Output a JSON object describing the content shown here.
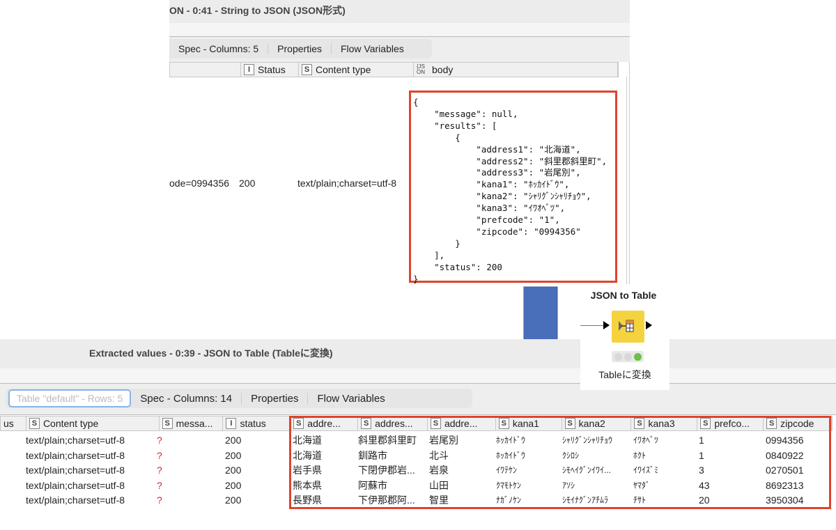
{
  "top_window": {
    "title": "ON - 0:41 - String to JSON (JSON形式)",
    "tabs": [
      "Spec - Columns: 5",
      "Properties",
      "Flow Variables"
    ],
    "columns": [
      {
        "type": "I",
        "label": "Status"
      },
      {
        "type": "S",
        "label": "Content type"
      },
      {
        "type": "{JS ON",
        "label": "body"
      }
    ],
    "row": {
      "partial_url": "ode=0994356",
      "status": "200",
      "content_type": "text/plain;charset=utf-8"
    },
    "json_body": "{\n    \"message\": null,\n    \"results\": [\n        {\n            \"address1\": \"北海道\",\n            \"address2\": \"斜里郡斜里町\",\n            \"address3\": \"岩尾別\",\n            \"kana1\": \"ﾎｯｶｲﾄﾞｳ\",\n            \"kana2\": \"ｼｬﾘｸﾞﾝｼｬﾘﾁｮｳ\",\n            \"kana3\": \"ｲﾜｵﾍﾞﾂ\",\n            \"prefcode\": \"1\",\n            \"zipcode\": \"0994356\"\n        }\n    ],\n    \"status\": 200\n}"
  },
  "node": {
    "title": "JSON to Table",
    "label": "Tableに変換",
    "color": "#f5d33f",
    "status_colors": [
      "#d8d8d8",
      "#d8d8d8",
      "#6cc04a"
    ]
  },
  "arrow_color": "#4a6fba",
  "highlight_color": "#e0432b",
  "bottom_window": {
    "title": "Extracted values - 0:39 - JSON to Table (Tableに変換)",
    "tabs": [
      "Table \"default\" - Rows: 5",
      "Spec - Columns: 14",
      "Properties",
      "Flow Variables"
    ],
    "columns": [
      {
        "type": "",
        "label": "us"
      },
      {
        "type": "S",
        "label": "Content type"
      },
      {
        "type": "S",
        "label": "messa..."
      },
      {
        "type": "I",
        "label": "status"
      },
      {
        "type": "S",
        "label": "addre..."
      },
      {
        "type": "S",
        "label": "addres..."
      },
      {
        "type": "S",
        "label": "addre..."
      },
      {
        "type": "S",
        "label": "kana1"
      },
      {
        "type": "S",
        "label": "kana2"
      },
      {
        "type": "S",
        "label": "kana3"
      },
      {
        "type": "S",
        "label": "prefco..."
      },
      {
        "type": "S",
        "label": "zipcode"
      }
    ],
    "rows": [
      [
        "",
        "text/plain;charset=utf-8",
        "?",
        "200",
        "北海道",
        "斜里郡斜里町",
        "岩尾別",
        "ﾎｯｶｲﾄﾞｳ",
        "ｼｬﾘｸﾞﾝｼｬﾘﾁｮｳ",
        "ｲﾜｵﾍﾞﾂ",
        "1",
        "0994356"
      ],
      [
        "",
        "text/plain;charset=utf-8",
        "?",
        "200",
        "北海道",
        "釧路市",
        "北斗",
        "ﾎｯｶｲﾄﾞｳ",
        "ｸｼﾛｼ",
        "ﾎｸﾄ",
        "1",
        "0840922"
      ],
      [
        "",
        "text/plain;charset=utf-8",
        "?",
        "200",
        "岩手県",
        "下閉伊郡岩...",
        "岩泉",
        "ｲﾜﾃｹﾝ",
        "ｼﾓﾍｲｸﾞﾝｲﾜｲ...",
        "ｲﾜｲｽﾞﾐ",
        "3",
        "0270501"
      ],
      [
        "",
        "text/plain;charset=utf-8",
        "?",
        "200",
        "熊本県",
        "阿蘇市",
        "山田",
        "ｸﾏﾓﾄｹﾝ",
        "ｱｿｼ",
        "ﾔﾏﾀﾞ",
        "43",
        "8692313"
      ],
      [
        "",
        "text/plain;charset=utf-8",
        "?",
        "200",
        "長野県",
        "下伊那郡阿...",
        "智里",
        "ﾅｶﾞﾉｹﾝ",
        "ｼﾓｲﾅｸﾞﾝｱﾁﾑﾗ",
        "ﾁｻﾄ",
        "20",
        "3950304"
      ]
    ]
  }
}
